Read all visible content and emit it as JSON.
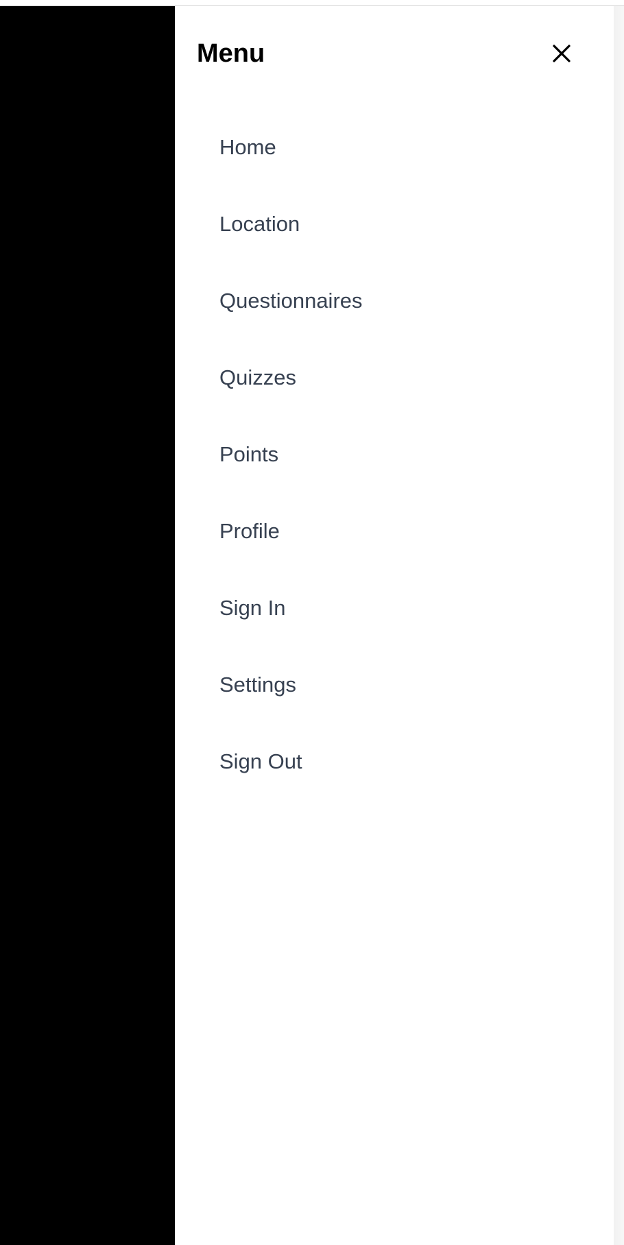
{
  "drawer": {
    "title": "Menu",
    "close_icon": "close-icon",
    "items": [
      {
        "label": "Home"
      },
      {
        "label": "Location"
      },
      {
        "label": "Questionnaires"
      },
      {
        "label": "Quizzes"
      },
      {
        "label": "Points"
      },
      {
        "label": "Profile"
      },
      {
        "label": "Sign In"
      },
      {
        "label": "Settings"
      },
      {
        "label": "Sign Out"
      }
    ]
  },
  "colors": {
    "overlay": "#000000",
    "drawer_background": "#ffffff",
    "menu_text": "#374151",
    "title_text": "#000000"
  }
}
